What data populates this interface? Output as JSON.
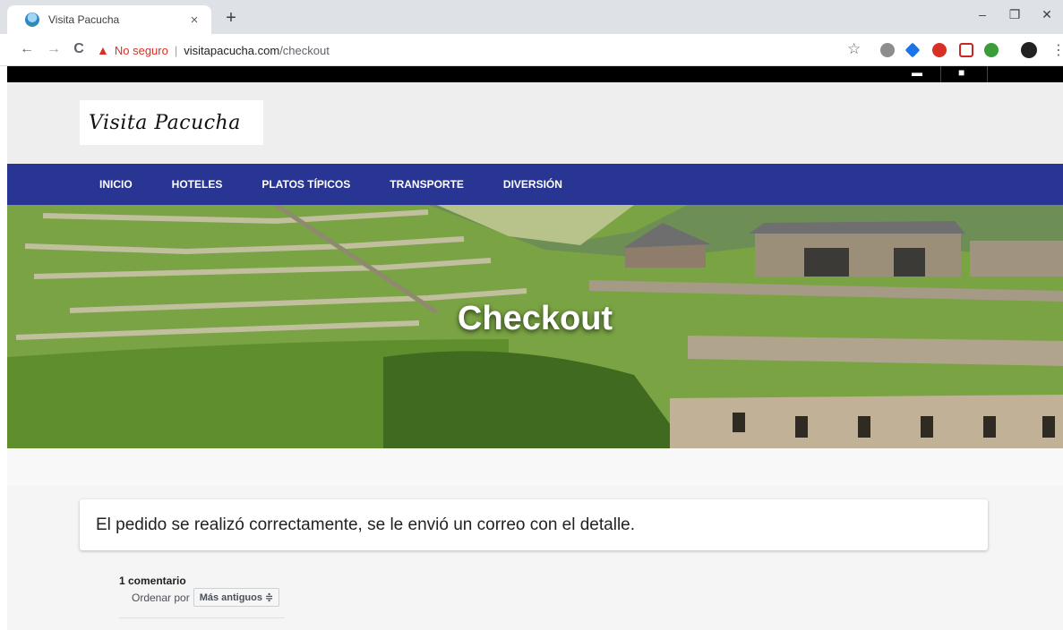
{
  "browser": {
    "tab_title": "Visita Pacucha",
    "tab_close": "×",
    "new_tab": "+",
    "security_label": "No seguro",
    "separator": "|",
    "url_host": "visitapacucha.com",
    "url_path": "/checkout",
    "back": "←",
    "forward": "→",
    "reload": "C",
    "minimize": "–",
    "restore": "❐",
    "close": "✕",
    "star": "☆",
    "menu": "⋮"
  },
  "site": {
    "logo_text": "Visita Pacucha",
    "nav": [
      "INICIO",
      "HOTELES",
      "PLATOS TÍPICOS",
      "TRANSPORTE",
      "DIVERSIÓN"
    ],
    "hero_title": "Checkout"
  },
  "order": {
    "message": "El pedido se realizó correctamente, se le envió un correo con el detalle."
  },
  "comments": {
    "count_label": "1 comentario",
    "sort_label": "Ordenar por",
    "sort_value": "Más antiguos ≑"
  },
  "colors": {
    "navbar": "#283593",
    "insecure_red": "#d93025",
    "topstrip": "#000000"
  },
  "icons": [
    "warning-icon",
    "star-icon",
    "cart-icon",
    "user-icon",
    "kebab-menu-icon"
  ]
}
